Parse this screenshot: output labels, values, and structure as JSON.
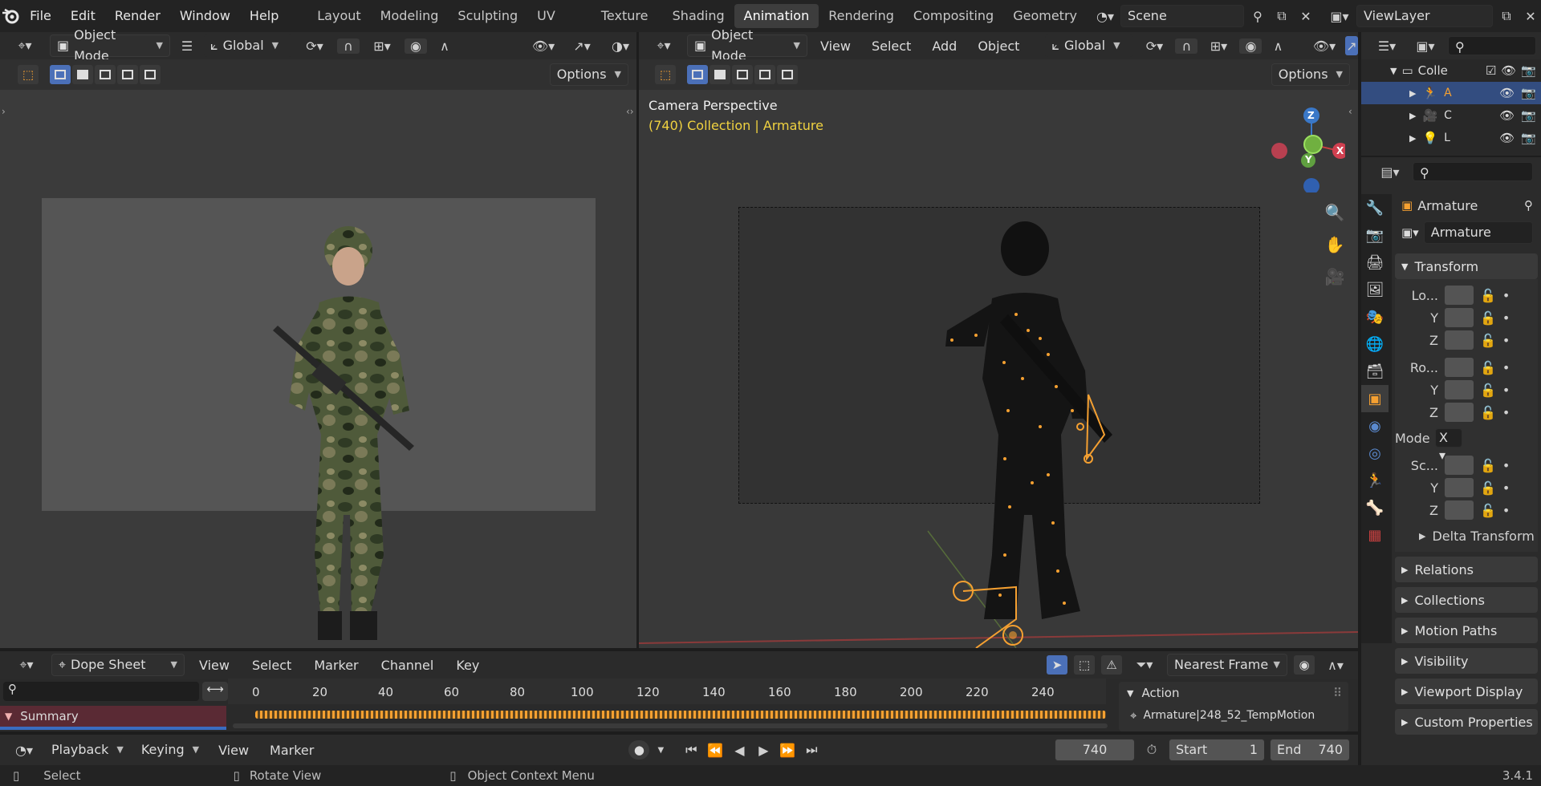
{
  "menubar": {
    "items": [
      "File",
      "Edit",
      "Render",
      "Window",
      "Help"
    ],
    "workspaces": [
      "Layout",
      "Modeling",
      "Sculpting",
      "UV Editing",
      "Texture Paint",
      "Shading",
      "Animation",
      "Rendering",
      "Compositing",
      "Geometry Node"
    ],
    "active_workspace": "Animation",
    "scene": "Scene",
    "view_layer": "ViewLayer"
  },
  "left_viewport": {
    "mode": "Object Mode",
    "orientation": "Global",
    "options": "Options"
  },
  "right_viewport": {
    "mode": "Object Mode",
    "menus": [
      "View",
      "Select",
      "Add",
      "Object"
    ],
    "orientation": "Global",
    "options": "Options",
    "overlay_title": "Camera Perspective",
    "overlay_subtitle": "(740) Collection | Armature",
    "gizmo": {
      "z": "Z",
      "y": "Y",
      "x": "X"
    }
  },
  "outliner": {
    "collection": "Colle",
    "items": [
      "A",
      "C",
      "L"
    ]
  },
  "properties": {
    "object_name": "Armature",
    "data_name": "Armature",
    "transform": {
      "title": "Transform",
      "location": "Lo...",
      "rotation": "Ro...",
      "scale": "Sc...",
      "y": "Y",
      "z": "Z",
      "mode_label": "Mode",
      "mode_value": "X"
    },
    "panels": [
      "Delta Transform",
      "Relations",
      "Collections",
      "Motion Paths",
      "Visibility",
      "Viewport Display",
      "Custom Properties"
    ]
  },
  "dopesheet": {
    "editor": "Dope Sheet",
    "menus": [
      "View",
      "Select",
      "Marker",
      "Channel",
      "Key"
    ],
    "snap": "Nearest Frame",
    "ruler": [
      "0",
      "20",
      "40",
      "60",
      "80",
      "100",
      "120",
      "140",
      "160",
      "180",
      "200",
      "220",
      "240"
    ],
    "summary": "Summary",
    "action_panel_title": "Action",
    "action_name": "Armature|248_52_TempMotion"
  },
  "timeline": {
    "menus": [
      "Playback",
      "Keying",
      "View",
      "Marker"
    ],
    "current_frame": "740",
    "start_label": "Start",
    "start_value": "1",
    "end_label": "End",
    "end_value": "740"
  },
  "statusbar": {
    "select": "Select",
    "rotate": "Rotate View",
    "context": "Object Context Menu",
    "version": "3.4.1"
  },
  "colors": {
    "accent": "#4b70b8",
    "selection_orange": "#f5a031",
    "overlay_yellow": "#f0d240"
  }
}
